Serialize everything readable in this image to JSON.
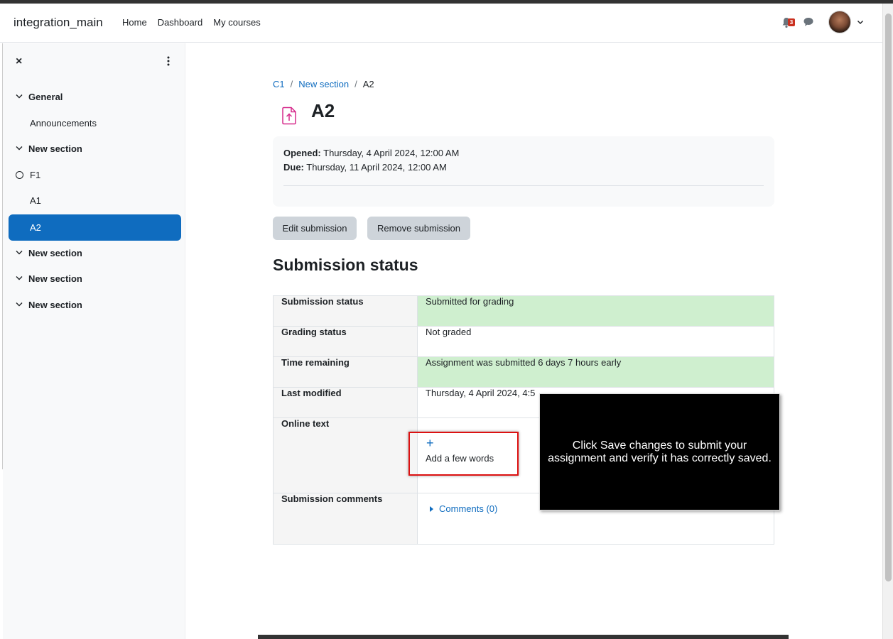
{
  "navbar": {
    "brand": "integration_main",
    "links": [
      "Home",
      "Dashboard",
      "My courses"
    ],
    "notification_count": "3"
  },
  "sidebar": {
    "close_label": "×",
    "items": [
      {
        "label": "General",
        "type": "section"
      },
      {
        "label": "Announcements",
        "type": "activity"
      },
      {
        "label": "New section",
        "type": "section"
      },
      {
        "label": "F1",
        "type": "activity-incomplete"
      },
      {
        "label": "A1",
        "type": "activity"
      },
      {
        "label": "A2",
        "type": "activity-active"
      },
      {
        "label": "New section",
        "type": "section"
      },
      {
        "label": "New section",
        "type": "section"
      },
      {
        "label": "New section",
        "type": "section"
      }
    ]
  },
  "breadcrumb": [
    {
      "label": "C1"
    },
    {
      "label": "New section"
    },
    {
      "label": "A2"
    }
  ],
  "page": {
    "title": "A2",
    "opened_label": "Opened:",
    "opened_value": "Thursday, 4 April 2024, 12:00 AM",
    "due_label": "Due:",
    "due_value": "Thursday, 11 April 2024, 12:00 AM"
  },
  "buttons": {
    "edit": "Edit submission",
    "remove": "Remove submission"
  },
  "submission": {
    "heading": "Submission status",
    "rows": {
      "status_label": "Submission status",
      "status_value": "Submitted for grading",
      "grading_label": "Grading status",
      "grading_value": "Not graded",
      "time_label": "Time remaining",
      "time_value": "Assignment was submitted 6 days 7 hours early",
      "modified_label": "Last modified",
      "modified_value": "Thursday, 4 April 2024, 4:5",
      "online_label": "Online text",
      "online_plus": "+",
      "online_value": "Add a few words",
      "comments_label": "Submission comments",
      "comments_value": "Comments (0)"
    }
  },
  "tooltip": {
    "line1": "Click Save changes to submit your",
    "line2": "assignment and verify it has correctly saved."
  },
  "colors": {
    "accent": "#0f6cbf",
    "success_bg": "#cfefcf",
    "badge": "#ca3120",
    "highlight": "#dd1111"
  }
}
